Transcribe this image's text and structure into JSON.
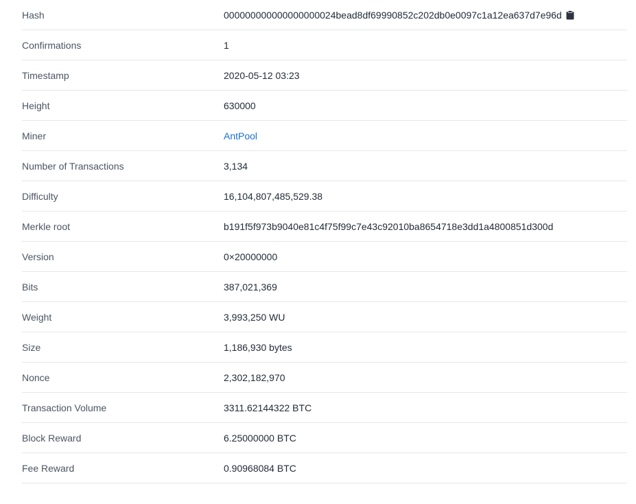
{
  "rows": [
    {
      "label": "Hash",
      "value": "000000000000000000024bead8df69990852c202db0e0097c1a12ea637d7e96d"
    },
    {
      "label": "Confirmations",
      "value": "1"
    },
    {
      "label": "Timestamp",
      "value": "2020-05-12 03:23"
    },
    {
      "label": "Height",
      "value": "630000"
    },
    {
      "label": "Miner",
      "value": "AntPool"
    },
    {
      "label": "Number of Transactions",
      "value": "3,134"
    },
    {
      "label": "Difficulty",
      "value": "16,104,807,485,529.38"
    },
    {
      "label": "Merkle root",
      "value": "b191f5f973b9040e81c4f75f99c7e43c92010ba8654718e3dd1a4800851d300d"
    },
    {
      "label": "Version",
      "value": "0×20000000"
    },
    {
      "label": "Bits",
      "value": "387,021,369"
    },
    {
      "label": "Weight",
      "value": "3,993,250 WU"
    },
    {
      "label": "Size",
      "value": "1,186,930 bytes"
    },
    {
      "label": "Nonce",
      "value": "2,302,182,970"
    },
    {
      "label": "Transaction Volume",
      "value": "3311.62144322 BTC"
    },
    {
      "label": "Block Reward",
      "value": "6.25000000 BTC"
    },
    {
      "label": "Fee Reward",
      "value": "0.90968084 BTC"
    }
  ],
  "icons": {
    "copy": "clipboard-icon"
  },
  "colors": {
    "link": "#1a6fd1",
    "label": "#4b5563",
    "value": "#1f2937",
    "divider": "#e5e7eb"
  }
}
